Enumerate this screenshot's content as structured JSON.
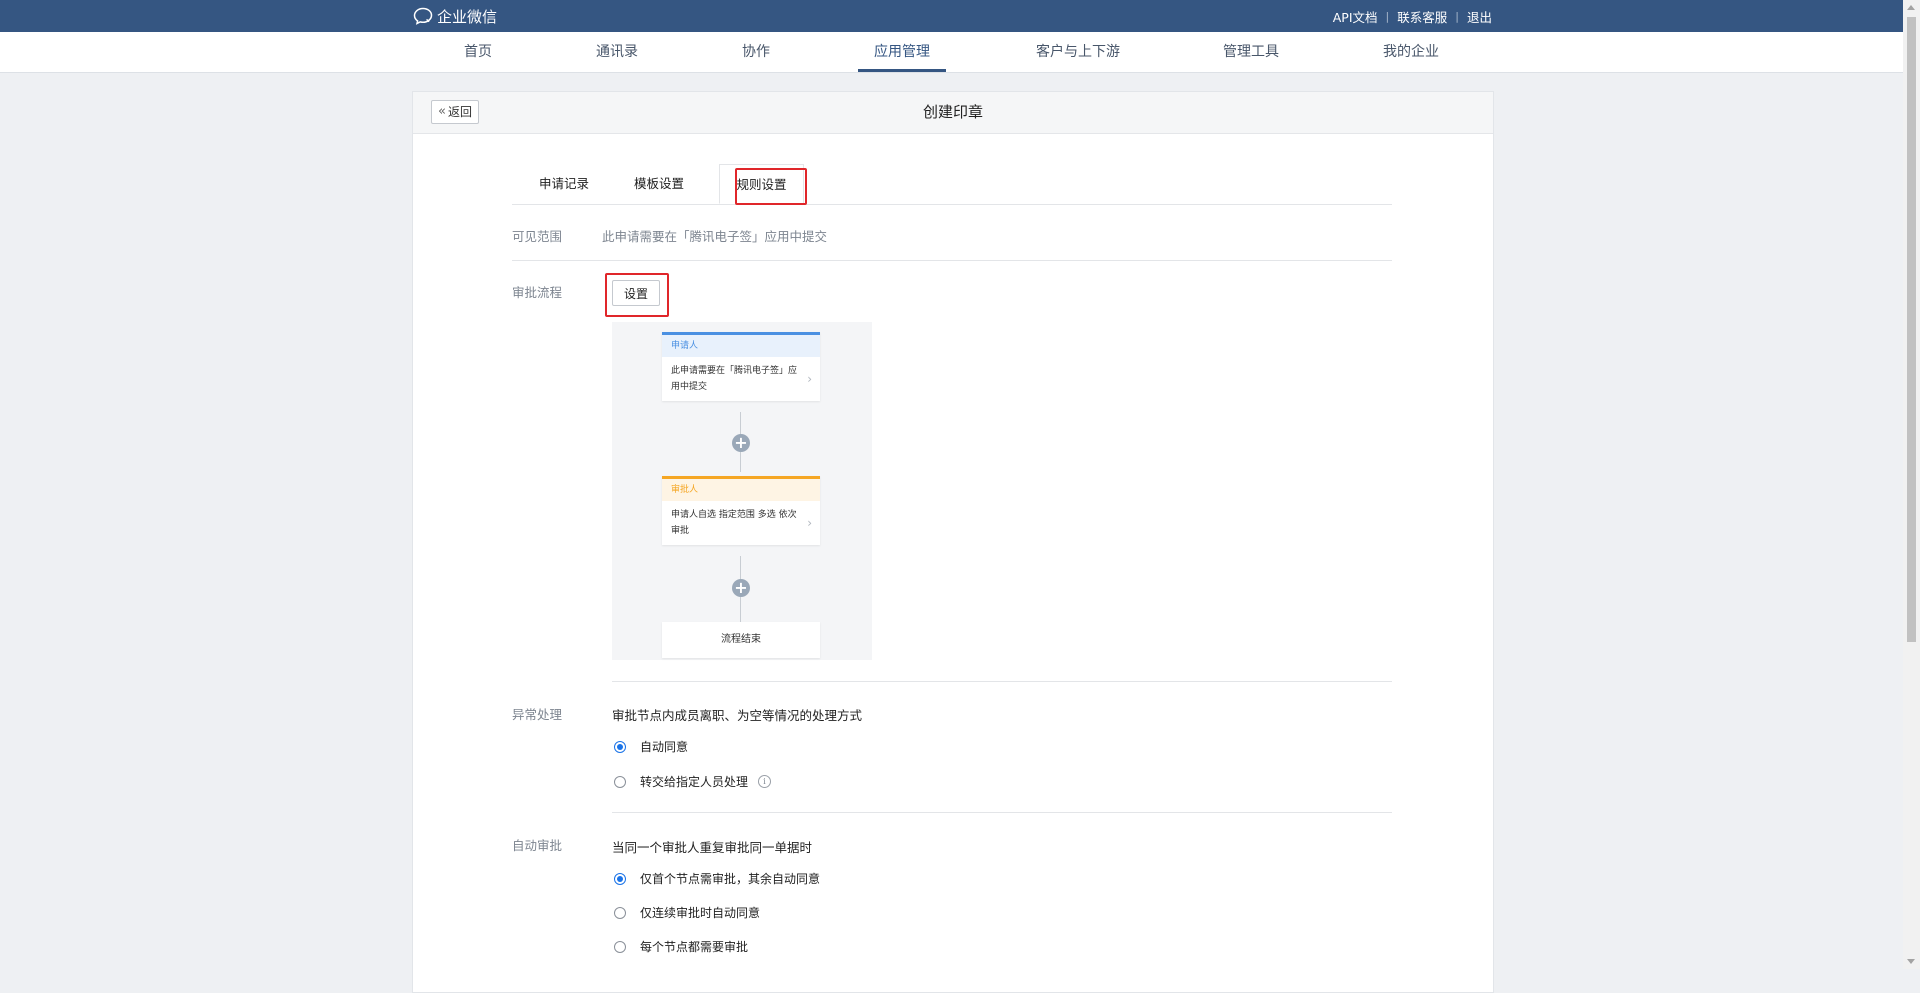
{
  "brand": {
    "name": "企业微信",
    "icon": "chat-bubble-icon"
  },
  "top_links": [
    "API文档",
    "联系客服",
    "退出"
  ],
  "nav": {
    "items": [
      "首页",
      "通讯录",
      "协作",
      "应用管理",
      "客户与上下游",
      "管理工具",
      "我的企业"
    ],
    "active": "应用管理"
  },
  "card": {
    "back_label": "返回",
    "title": "创建印章"
  },
  "tabs": {
    "items": [
      "申请记录",
      "模板设置",
      "规则设置"
    ],
    "active": "规则设置"
  },
  "visible_scope": {
    "label": "可见范围",
    "text": "此申请需要在「腾讯电子签」应用中提交"
  },
  "approval_flow": {
    "label": "审批流程",
    "button": "设置",
    "applicant_node": {
      "title": "申请人",
      "body": "此申请需要在「腾讯电子签」应用中提交",
      "color": "#4a90e2"
    },
    "approver_node": {
      "title": "审批人",
      "body": "申请人自选 指定范围 多选 依次审批",
      "color": "#f5a623"
    },
    "end_node": "流程结束"
  },
  "exception": {
    "label": "异常处理",
    "desc": "审批节点内成员离职、为空等情况的处理方式",
    "options": [
      "自动同意",
      "转交给指定人员处理"
    ],
    "selected": "自动同意"
  },
  "auto_approve": {
    "label": "自动审批",
    "desc": "当同一个审批人重复审批同一单据时",
    "options": [
      "仅首个节点需审批，其余自动同意",
      "仅连续审批时自动同意",
      "每个节点都需要审批"
    ],
    "selected": "仅首个节点需审批，其余自动同意"
  },
  "colors": {
    "topbar": "#355682",
    "highlight": "#e0262a",
    "radio": "#1a73e8"
  }
}
